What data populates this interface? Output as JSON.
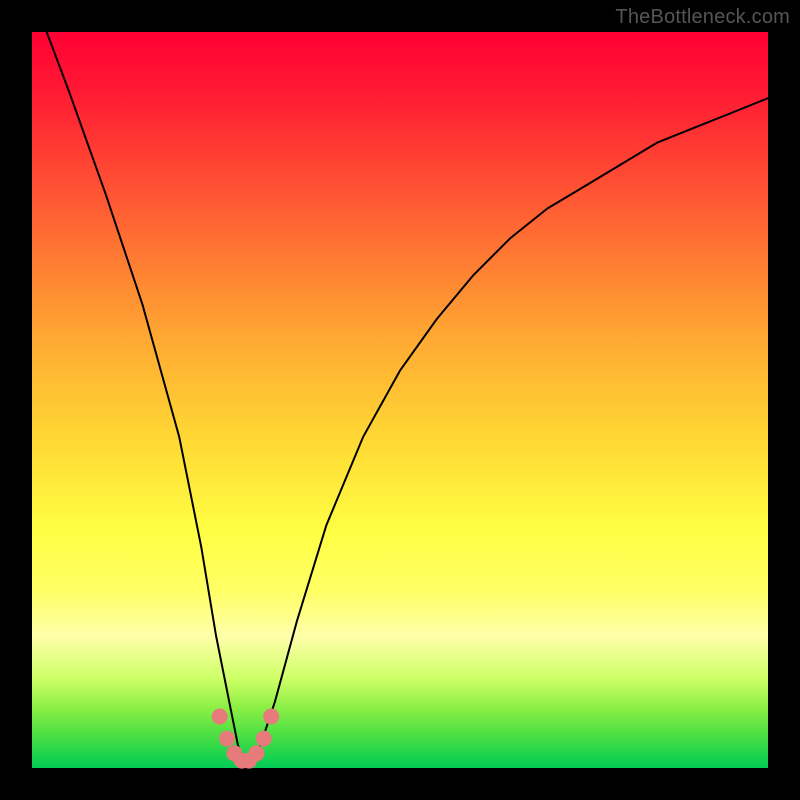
{
  "watermark": "TheBottleneck.com",
  "chart_data": {
    "type": "line",
    "title": "",
    "xlabel": "",
    "ylabel": "",
    "x_range": [
      0,
      100
    ],
    "y_range": [
      0,
      100
    ],
    "series": [
      {
        "name": "bottleneck-curve",
        "x": [
          2,
          5,
          10,
          15,
          20,
          23,
          25,
          27,
          28,
          29,
          30,
          31,
          33,
          36,
          40,
          45,
          50,
          55,
          60,
          65,
          70,
          75,
          80,
          85,
          90,
          95,
          100
        ],
        "y": [
          100,
          92,
          78,
          63,
          45,
          30,
          18,
          8,
          3,
          1,
          1,
          3,
          9,
          20,
          33,
          45,
          54,
          61,
          67,
          72,
          76,
          79,
          82,
          85,
          87,
          89,
          91
        ]
      }
    ],
    "markers": {
      "name": "highlight-dots",
      "color": "#e77a7a",
      "x": [
        25.5,
        26.5,
        27.5,
        28.5,
        29.5,
        30.5,
        31.5,
        32.5
      ],
      "y": [
        7,
        4,
        2,
        1,
        1,
        2,
        4,
        7
      ]
    }
  }
}
